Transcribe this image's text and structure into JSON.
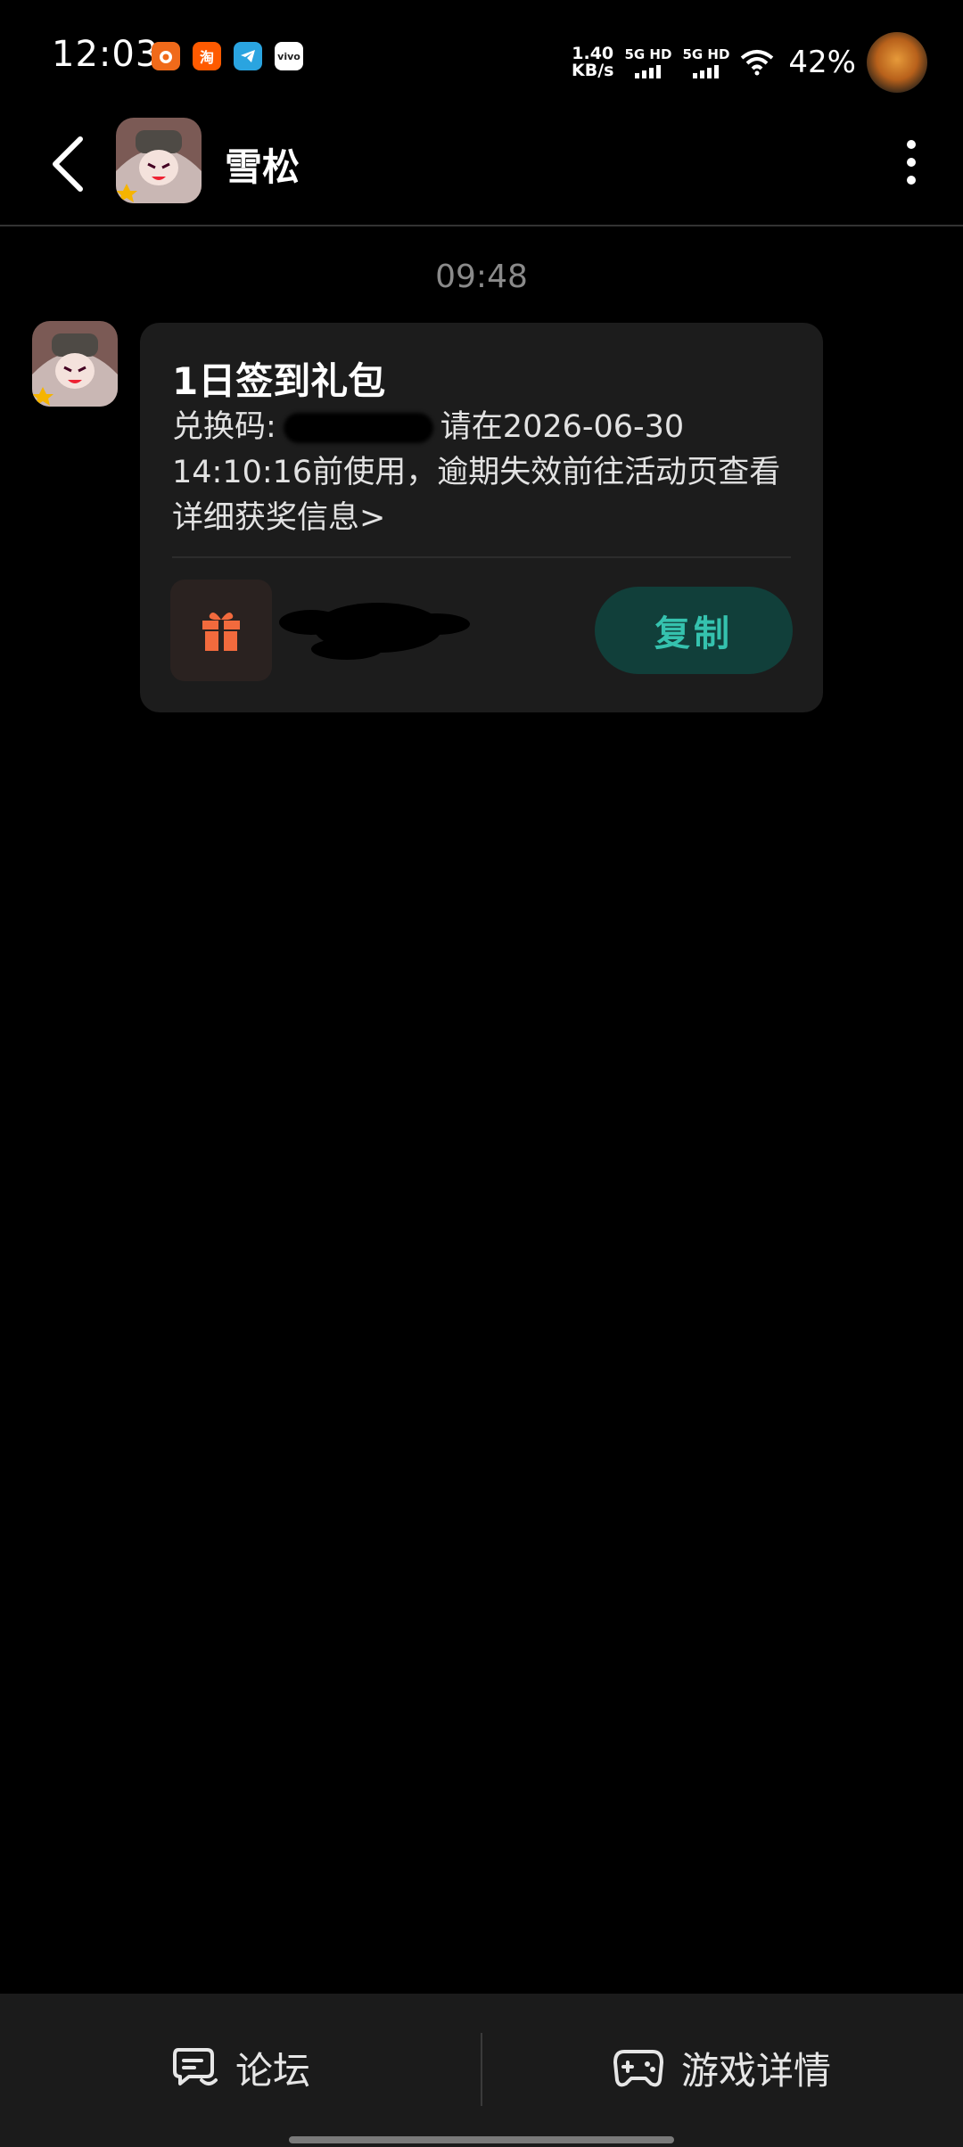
{
  "status_bar": {
    "time": "12:03",
    "app_icons": [
      "orange-app-icon",
      "taobao-icon",
      "telegram-icon",
      "vivo-icon"
    ],
    "taobao_char": "淘",
    "vivo_text": "vivo",
    "net_speed_value": "1.40",
    "net_speed_unit": "KB/s",
    "sim1": "5G HD",
    "sim2": "5G HD",
    "battery": "42%"
  },
  "header": {
    "title": "雪松"
  },
  "chat": {
    "timestamp": "09:48",
    "card": {
      "title": "1日签到礼包",
      "code_label": "兑换码:",
      "body_after_code": "请在2026-06-30 14:10:16前使用，逾期失效前往活动页查看详细获奖信息>",
      "copy_button": "复制"
    }
  },
  "bottom_bar": {
    "forum_label": "论坛",
    "game_label": "游戏详情"
  },
  "colors": {
    "accent_teal": "#35c2ae",
    "gift_orange": "#f26a3d"
  }
}
